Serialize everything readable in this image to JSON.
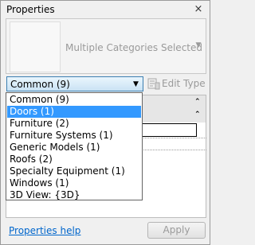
{
  "panel": {
    "title": "Properties",
    "close_glyph": "×"
  },
  "type_selector": {
    "label": "Multiple Categories Selected"
  },
  "filter": {
    "selected": "Common (9)",
    "edit_type_label": "Edit Type",
    "options": [
      "Common (9)",
      "Doors (1)",
      "Furniture (2)",
      "Furniture Systems (1)",
      "Generic Models (1)",
      "Roofs (2)",
      "Specialty Equipment (1)",
      "Windows (1)",
      "3D View: {3D}"
    ],
    "highlighted_index": 1
  },
  "footer": {
    "help_link": "Properties help",
    "apply_label": "Apply"
  },
  "colors": {
    "highlight": "#3399ff",
    "link": "#0066cc",
    "disabled_text": "#9a9a9a"
  }
}
